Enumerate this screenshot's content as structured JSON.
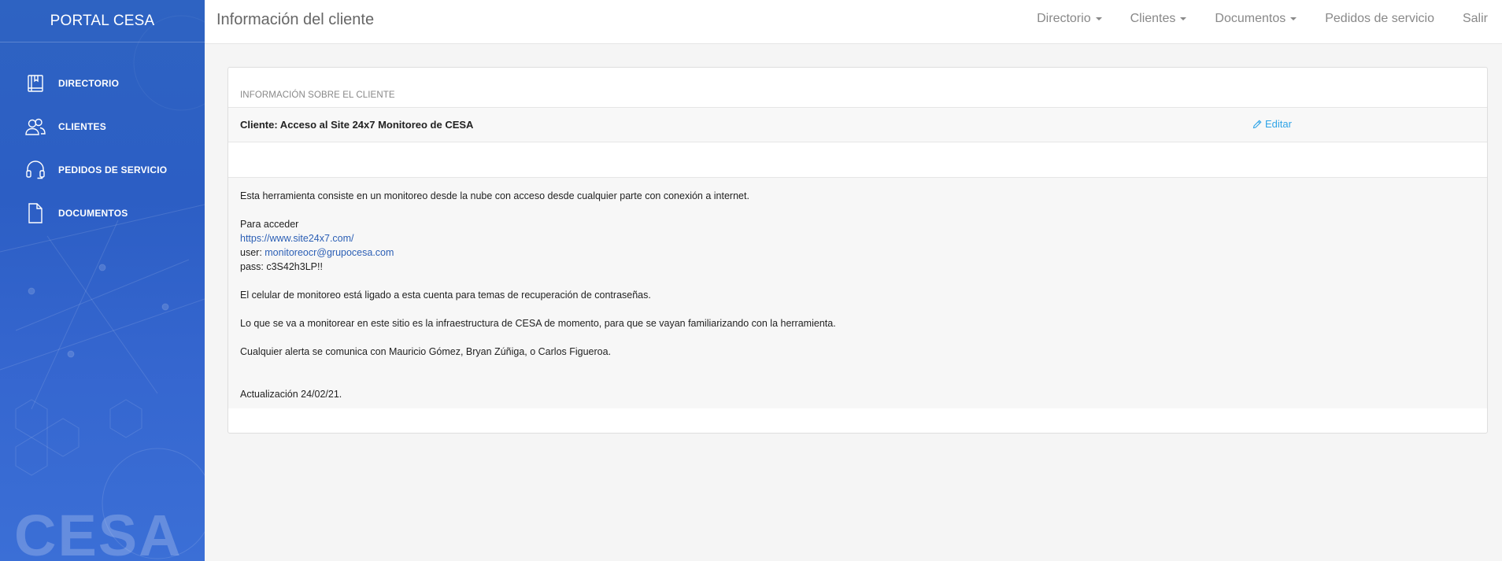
{
  "sidebar": {
    "brand": "PORTAL CESA",
    "items": [
      {
        "label": "DIRECTORIO",
        "icon": "book-icon"
      },
      {
        "label": "CLIENTES",
        "icon": "users-icon"
      },
      {
        "label": "PEDIDOS DE SERVICIO",
        "icon": "headset-icon"
      },
      {
        "label": "DOCUMENTOS",
        "icon": "document-icon"
      }
    ],
    "watermark": "CESA"
  },
  "header": {
    "title": "Información del cliente",
    "nav": [
      {
        "label": "Directorio",
        "dropdown": true
      },
      {
        "label": "Clientes",
        "dropdown": true
      },
      {
        "label": "Documentos",
        "dropdown": true
      },
      {
        "label": "Pedidos de servicio",
        "dropdown": false
      },
      {
        "label": "Salir",
        "dropdown": false
      }
    ]
  },
  "panel": {
    "header": "INFORMACIÓN SOBRE EL CLIENTE",
    "client_title": "Cliente: Acceso al Site 24x7 Monitoreo de CESA",
    "edit_label": "Editar",
    "content": {
      "intro": "Esta herramienta consiste en un monitoreo desde la nube con acceso desde cualquier parte con conexión a internet.",
      "access_label": "Para acceder",
      "url": "https://www.site24x7.com/",
      "user_prefix": "user: ",
      "user_email": "monitoreocr@grupocesa.com",
      "pass_line": "pass: c3S42h3LP!!",
      "note_phone": "El celular de monitoreo está ligado a esta cuenta para temas de recuperación de contraseñas.",
      "note_scope": "Lo que se va a monitorear en este sitio es la infraestructura de CESA de momento, para que se vayan familiarizando con la herramienta.",
      "note_alerts": "Cualquier alerta se comunica con Mauricio Gómez, Bryan Zúñiga, o Carlos Figueroa.",
      "updated": "Actualización 24/02/21."
    }
  },
  "colors": {
    "sidebar": "#2e63c2",
    "link": "#2c5fb5",
    "edit_link": "#2fa4e7"
  }
}
